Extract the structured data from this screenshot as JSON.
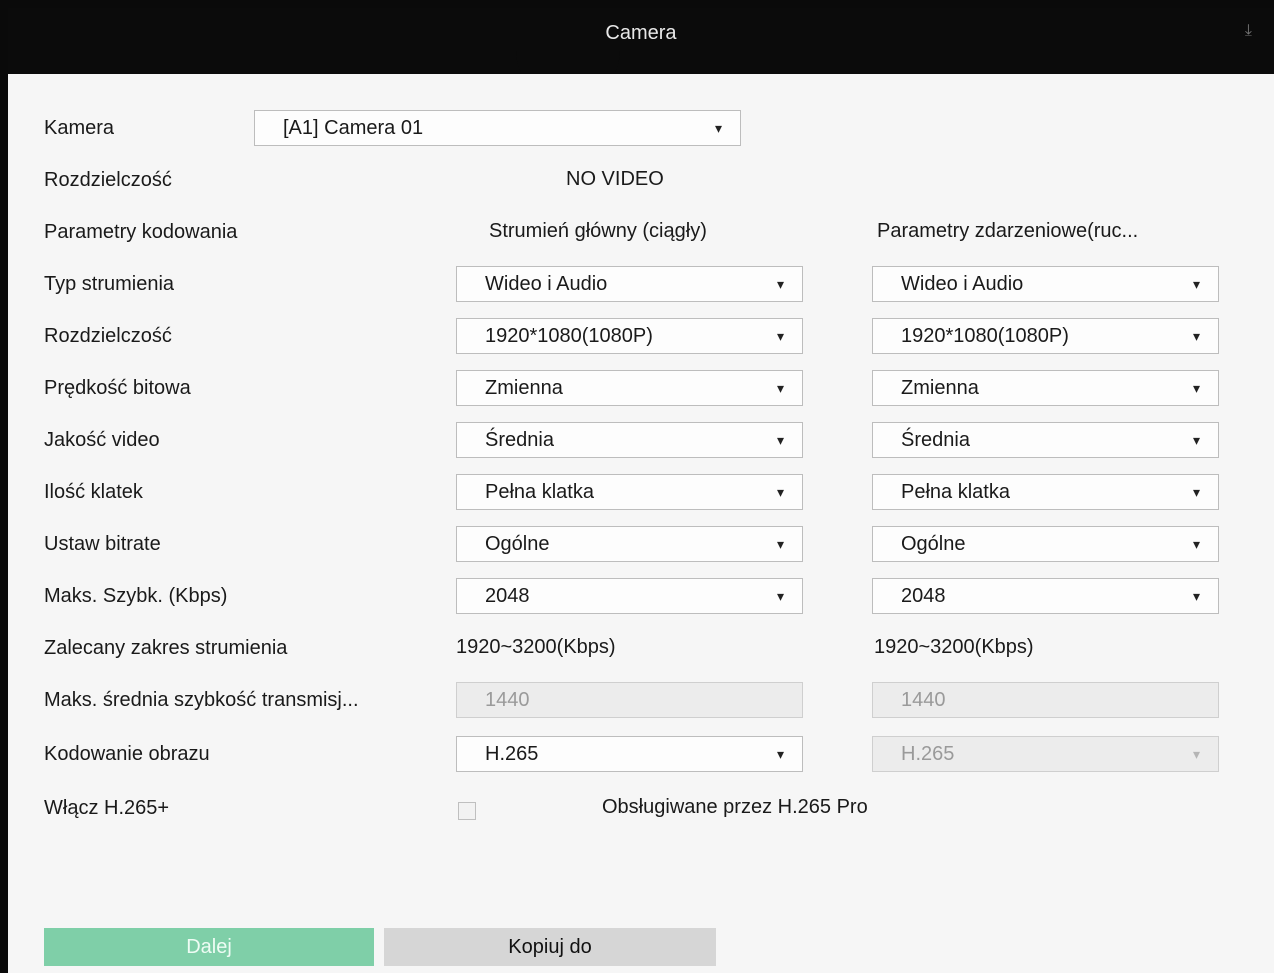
{
  "window": {
    "title": "Camera",
    "corner_icon": "download-icon"
  },
  "camera": {
    "label": "Kamera",
    "value": "[A1] Camera 01"
  },
  "resolution_info": {
    "label": "Rozdzielczość",
    "value": "NO VIDEO"
  },
  "columns": {
    "label": "Parametry kodowania",
    "main": "Strumień główny (ciągły)",
    "event": "Parametry zdarzeniowe(ruc..."
  },
  "rows": [
    {
      "label": "Typ strumienia",
      "main": "Wideo i Audio",
      "event": "Wideo i Audio"
    },
    {
      "label": "Rozdzielczość",
      "main": "1920*1080(1080P)",
      "event": "1920*1080(1080P)"
    },
    {
      "label": "Prędkość bitowa",
      "main": "Zmienna",
      "event": "Zmienna"
    },
    {
      "label": "Jakość video",
      "main": "Średnia",
      "event": "Średnia"
    },
    {
      "label": "Ilość klatek",
      "main": "Pełna klatka",
      "event": "Pełna klatka"
    },
    {
      "label": "Ustaw bitrate",
      "main": "Ogólne",
      "event": "Ogólne"
    },
    {
      "label": "Maks. Szybk. (Kbps)",
      "main": "2048",
      "event": "2048"
    }
  ],
  "recommended": {
    "label": "Zalecany zakres strumienia",
    "main": "1920~3200(Kbps)",
    "event": "1920~3200(Kbps)"
  },
  "avg_rate": {
    "label": "Maks. średnia szybkość transmisj...",
    "main": "1440",
    "event": "1440"
  },
  "encoding": {
    "label": "Kodowanie obrazu",
    "main": "H.265",
    "event": "H.265"
  },
  "h265plus": {
    "label": "Włącz H.265+",
    "note": "Obsługiwane przez H.265 Pro",
    "checked": false
  },
  "buttons": {
    "next": "Dalej",
    "copy": "Kopiuj do"
  },
  "colors": {
    "titlebar": "#0b0b0b",
    "next_button": "#7fcfa8",
    "copy_button": "#d6d6d6"
  }
}
